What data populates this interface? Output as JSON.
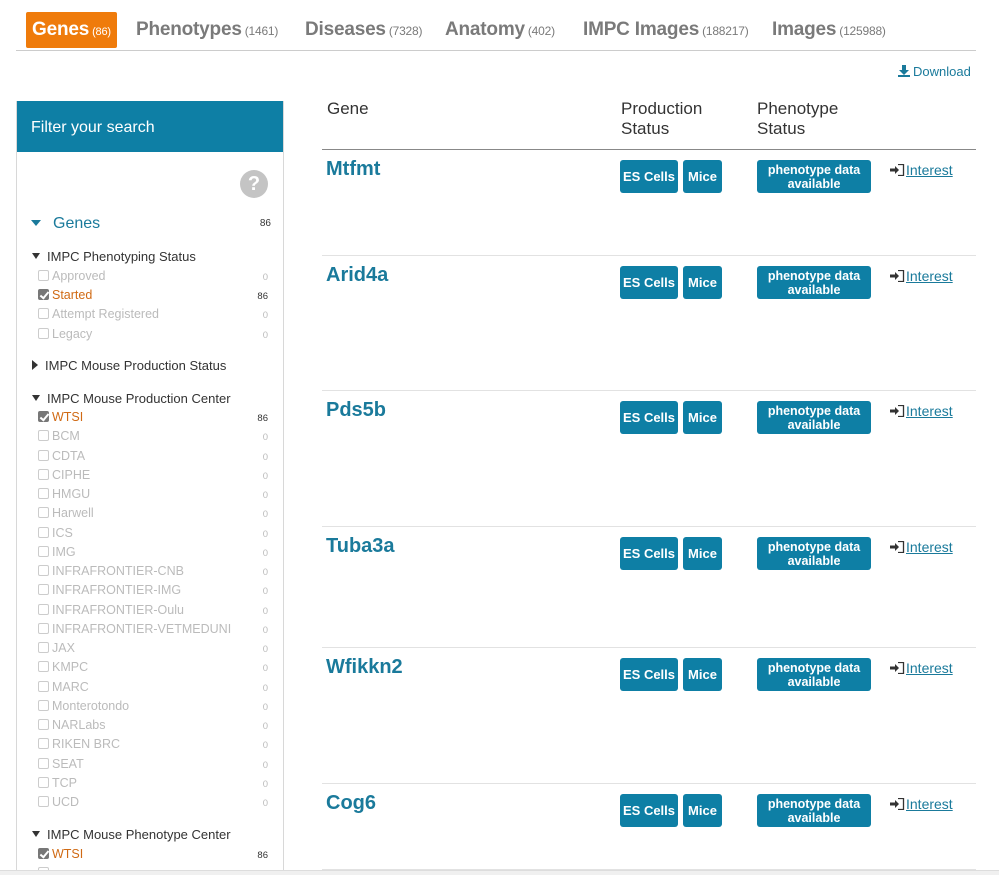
{
  "tabs": [
    {
      "label": "Genes",
      "count": "(86)"
    },
    {
      "label": "Phenotypes",
      "count": "(1461)"
    },
    {
      "label": "Diseases",
      "count": "(7328)"
    },
    {
      "label": "Anatomy",
      "count": "(402)"
    },
    {
      "label": "IMPC Images",
      "count": "(188217)"
    },
    {
      "label": "Images",
      "count": "(125988)"
    }
  ],
  "download_label": "Download",
  "sidebar": {
    "title": "Filter your search",
    "help_icon": "?",
    "genes_label": "Genes",
    "genes_count": "86",
    "sections": [
      {
        "label": "IMPC Phenotyping Status"
      },
      {
        "label": "IMPC Mouse Production Status"
      },
      {
        "label": "IMPC Mouse Production Center"
      },
      {
        "label": "IMPC Mouse Phenotype Center"
      }
    ],
    "phenotyping_status": [
      {
        "label": "Approved",
        "count": "0"
      },
      {
        "label": "Started",
        "count": "86"
      },
      {
        "label": "Attempt Registered",
        "count": "0"
      },
      {
        "label": "Legacy",
        "count": "0"
      }
    ],
    "production_center": [
      {
        "label": "WTSI",
        "count": "86"
      },
      {
        "label": "BCM",
        "count": "0"
      },
      {
        "label": "CDTA",
        "count": "0"
      },
      {
        "label": "CIPHE",
        "count": "0"
      },
      {
        "label": "HMGU",
        "count": "0"
      },
      {
        "label": "Harwell",
        "count": "0"
      },
      {
        "label": "ICS",
        "count": "0"
      },
      {
        "label": "IMG",
        "count": "0"
      },
      {
        "label": "INFRAFRONTIER-CNB",
        "count": "0"
      },
      {
        "label": "INFRAFRONTIER-IMG",
        "count": "0"
      },
      {
        "label": "INFRAFRONTIER-Oulu",
        "count": "0"
      },
      {
        "label": "INFRAFRONTIER-VETMEDUNI",
        "count": "0"
      },
      {
        "label": "JAX",
        "count": "0"
      },
      {
        "label": "KMPC",
        "count": "0"
      },
      {
        "label": "MARC",
        "count": "0"
      },
      {
        "label": "Monterotondo",
        "count": "0"
      },
      {
        "label": "NARLabs",
        "count": "0"
      },
      {
        "label": "RIKEN BRC",
        "count": "0"
      },
      {
        "label": "SEAT",
        "count": "0"
      },
      {
        "label": "TCP",
        "count": "0"
      },
      {
        "label": "UCD",
        "count": "0"
      }
    ],
    "phenotype_center": [
      {
        "label": "WTSI",
        "count": "86"
      }
    ]
  },
  "table": {
    "headers": {
      "gene": "Gene",
      "production_line1": "Production",
      "production_line2": "Status",
      "phenotype_line1": "Phenotype",
      "phenotype_line2": "Status"
    },
    "rows": [
      {
        "gene": "Mtfmt"
      },
      {
        "gene": "Arid4a"
      },
      {
        "gene": "Pds5b"
      },
      {
        "gene": "Tuba3a"
      },
      {
        "gene": "Wfikkn2"
      },
      {
        "gene": "Cog6"
      }
    ],
    "es_cells_label": "ES Cells",
    "mice_label": "Mice",
    "pheno_line1": "phenotype data",
    "pheno_line2": "available",
    "interest_label": "Interest"
  },
  "colors": {
    "active_tab": "#ef7b0b",
    "primary": "#0e7fa5",
    "link": "#1a7a9b",
    "checked_label": "#d06a14"
  }
}
